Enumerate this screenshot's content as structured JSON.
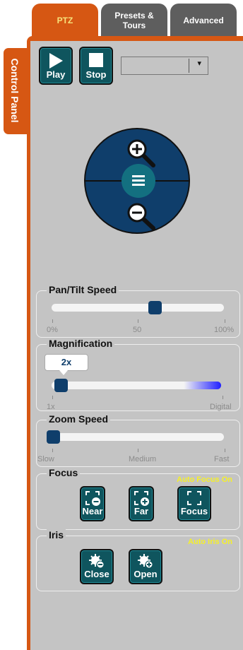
{
  "tabs": [
    {
      "label_line1": "PTZ",
      "label_line2": ""
    },
    {
      "label_line1": "Presets &",
      "label_line2": "Tours"
    },
    {
      "label_line1": "Advanced",
      "label_line2": ""
    }
  ],
  "side_tab": {
    "label": "Control Panel"
  },
  "controls": {
    "play_label": "Play",
    "stop_label": "Stop",
    "speed_select_value": "",
    "select_arrow": "▾"
  },
  "joystick": {
    "zoom_in_icon": "zoom-in-icon",
    "zoom_out_icon": "zoom-out-icon",
    "menu_icon": "menu-icon"
  },
  "pan_tilt": {
    "legend": "Pan/Tilt Speed",
    "value_fraction": 0.61,
    "ticks": [
      "0%",
      "50",
      "100%"
    ]
  },
  "magnification": {
    "legend": "Magnification",
    "current": "2x",
    "value_fraction": 0.02,
    "ticks": [
      "1x",
      "Digital"
    ]
  },
  "zoom_speed": {
    "legend": "Zoom Speed",
    "value_fraction": 0.0,
    "ticks": [
      "Slow",
      "Medium",
      "Fast"
    ]
  },
  "focus": {
    "legend": "Focus",
    "status": "Auto Focus On",
    "buttons": [
      "Near",
      "Far",
      "Focus"
    ]
  },
  "iris": {
    "legend": "Iris",
    "status": "Auto Iris On",
    "buttons": [
      "Close",
      "Open"
    ]
  },
  "colors": {
    "accent": "#d65713",
    "panel": "#c4c4c4",
    "button": "#0f555e",
    "thumb": "#0f3e6b",
    "status": "#f5f02a"
  }
}
